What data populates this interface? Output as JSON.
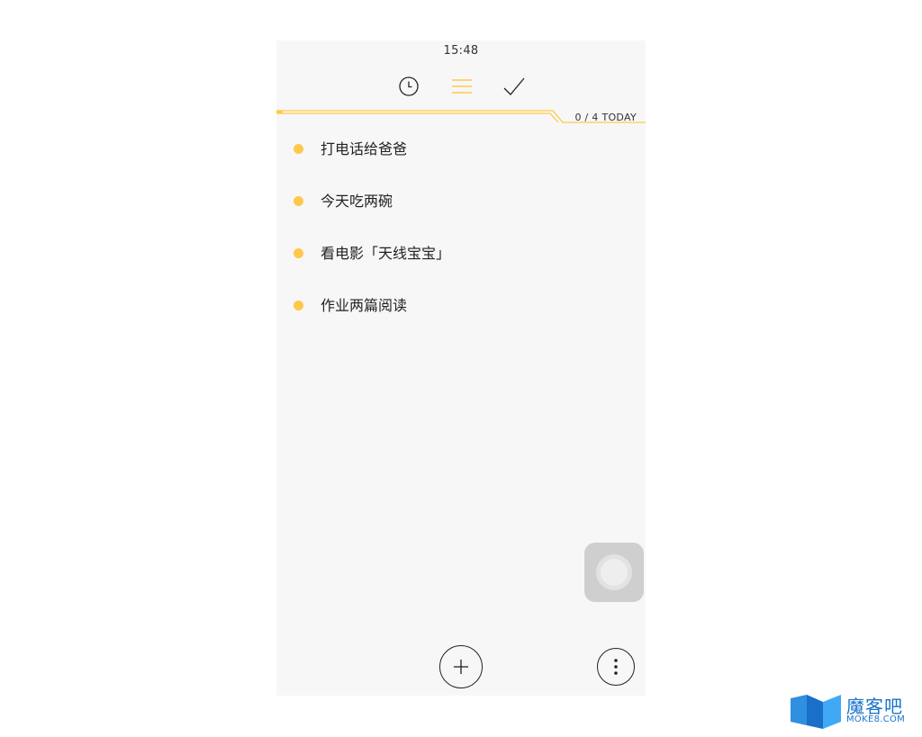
{
  "status_bar": {
    "time": "15:48"
  },
  "tabs": [
    {
      "name": "history",
      "icon": "clock-icon"
    },
    {
      "name": "list",
      "icon": "list-icon",
      "active": true
    },
    {
      "name": "done",
      "icon": "check-icon"
    }
  ],
  "progress": {
    "label": "0 / 4 TODAY",
    "completed": 0,
    "total": 4,
    "accent": "#ffc84a"
  },
  "tasks": [
    {
      "text": "打电话给爸爸"
    },
    {
      "text": "今天吃两碗"
    },
    {
      "text": "看电影「天线宝宝」"
    },
    {
      "text": "作业两篇阅读"
    }
  ],
  "bottom_bar": {
    "add_icon": "plus-icon",
    "more_icon": "more-vertical-icon"
  },
  "floating_assist": {
    "icon": "assistive-touch-icon"
  },
  "watermark": {
    "cn": "魔客吧",
    "en": "MOKE8.COM"
  },
  "colors": {
    "accent": "#ffc84a",
    "background": "#f7f7f7",
    "text": "#222222"
  }
}
